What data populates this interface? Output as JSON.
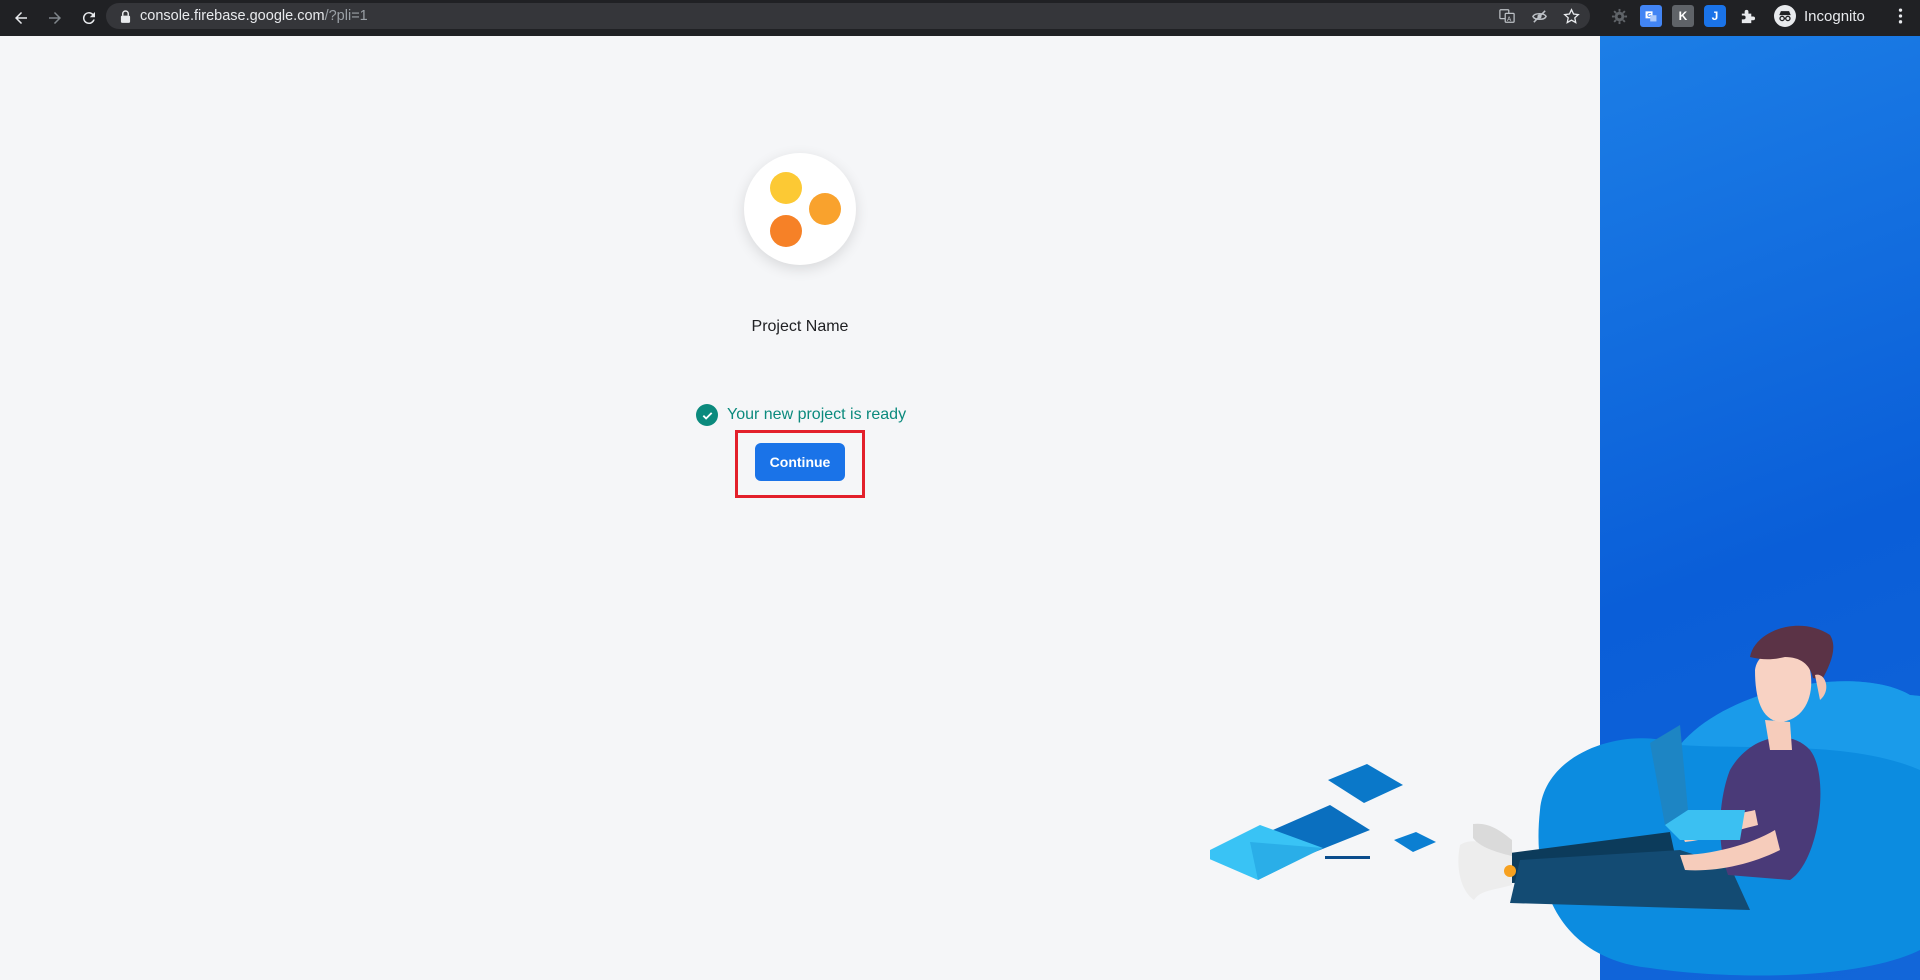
{
  "browser": {
    "url_main": "console.firebase.google.com",
    "url_dim": "/?pli=1",
    "profile_label": "Incognito",
    "extensions": [
      {
        "icon": "google-translate-icon",
        "color": "#4285f4"
      },
      {
        "icon": "k-extension-icon",
        "label": "K",
        "color": "#5f6368"
      },
      {
        "icon": "j-extension-icon",
        "label": "J",
        "color": "#1a73e8"
      },
      {
        "icon": "puzzle-icon"
      }
    ]
  },
  "project": {
    "name": "Project Name",
    "status_message": "Your new project is ready",
    "continue_label": "Continue"
  },
  "colors": {
    "accent": "#1a73e8",
    "success": "#0b8a7d",
    "highlight": "#e3202b",
    "panel": "#0a5ed8"
  }
}
